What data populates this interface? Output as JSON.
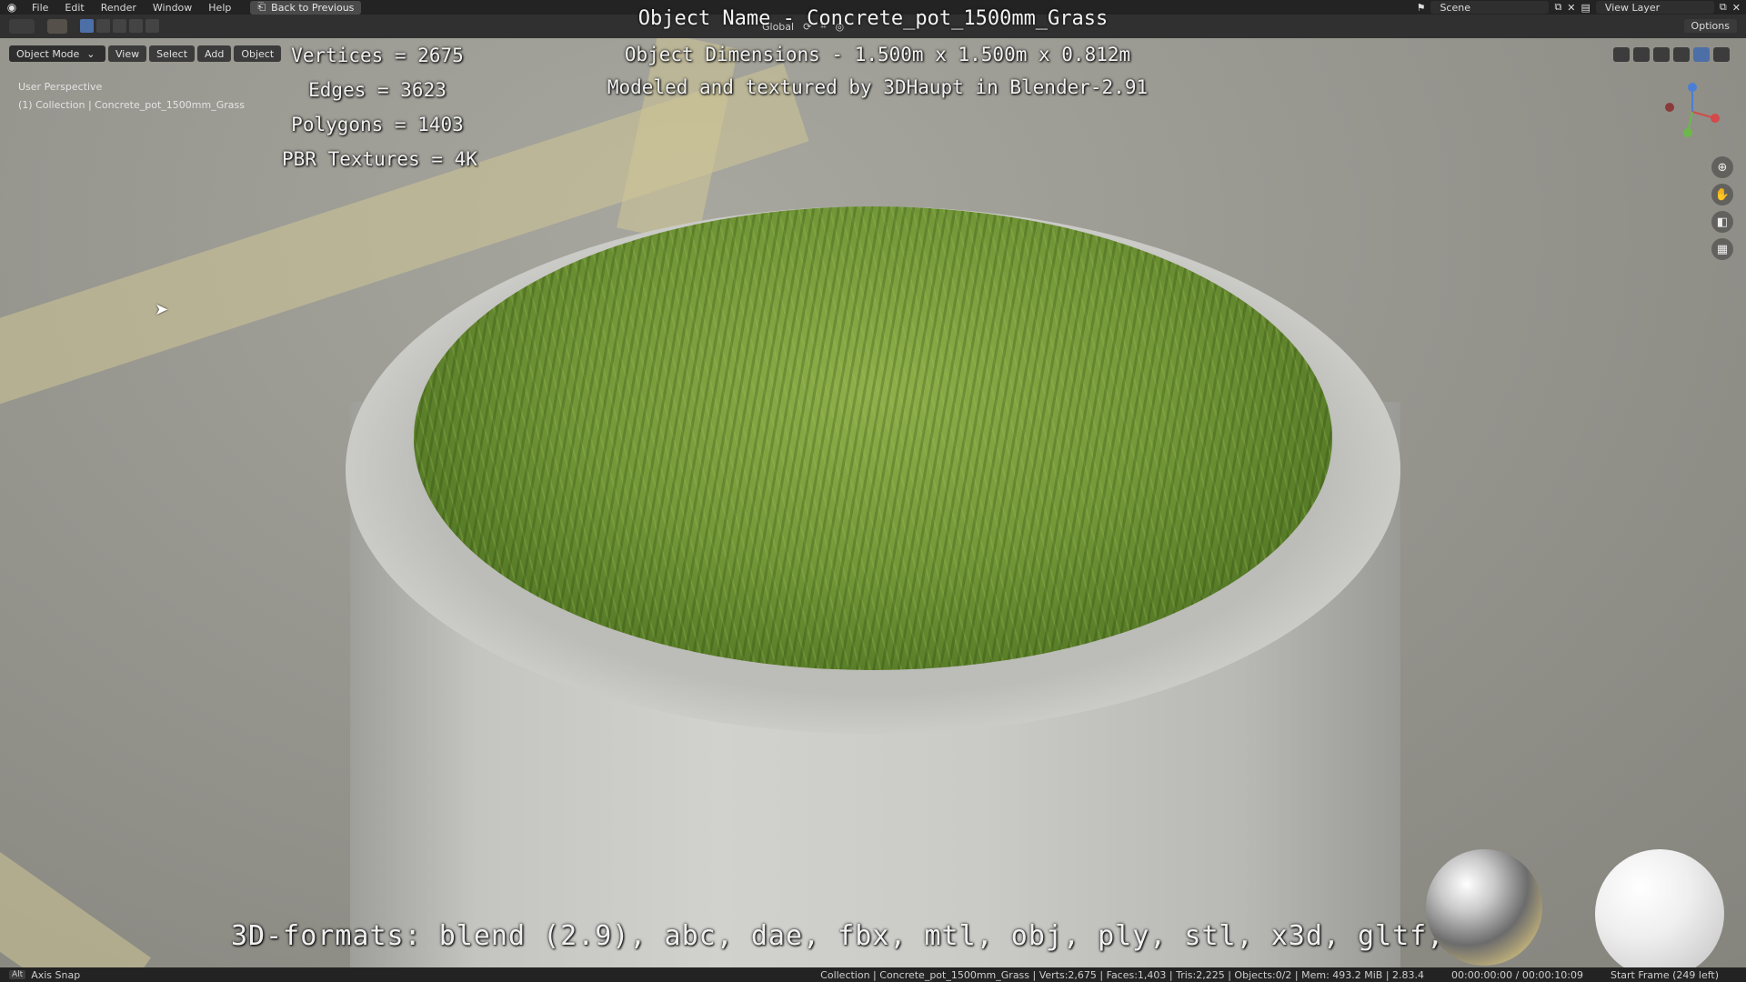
{
  "menubar": {
    "items": [
      "File",
      "Edit",
      "Render",
      "Window",
      "Help"
    ],
    "back_button": "Back to Previous",
    "scene": "Scene",
    "view_layer": "View Layer"
  },
  "header": {
    "options": "Options",
    "transform_orientation": "Global"
  },
  "viewport": {
    "mode": "Object Mode",
    "buttons": [
      "View",
      "Select",
      "Add",
      "Object"
    ],
    "perspective": "User Perspective",
    "collection": "(1) Collection | Concrete_pot_1500mm_Grass"
  },
  "overlay": {
    "title": "Object Name - Concrete_pot_1500mm_Grass",
    "vertices": "Vertices = 2675",
    "edges": "Edges = 3623",
    "polygons": "Polygons = 1403",
    "textures": "PBR Textures = 4K",
    "dimensions": "Object Dimensions -  1.500m x 1.500m x 0.812m",
    "credit": "Modeled and textured by 3DHaupt in Blender-2.91",
    "formats": "3D-formats: blend (2.9), abc, dae, fbx, mtl, obj, ply, stl, x3d, gltf, dxf"
  },
  "statusbar": {
    "key": "Alt",
    "action": "Axis Snap",
    "stats": "Collection | Concrete_pot_1500mm_Grass | Verts:2,675 | Faces:1,403 | Tris:2,225 | Objects:0/2 | Mem: 493.2 MiB | 2.83.4",
    "time": "00:00:00:00 / 00:00:10:09",
    "frame": "Start Frame (249 left)"
  },
  "icons": {
    "blender": "blender-logo-icon",
    "cursor": "mouse-cursor-icon"
  }
}
